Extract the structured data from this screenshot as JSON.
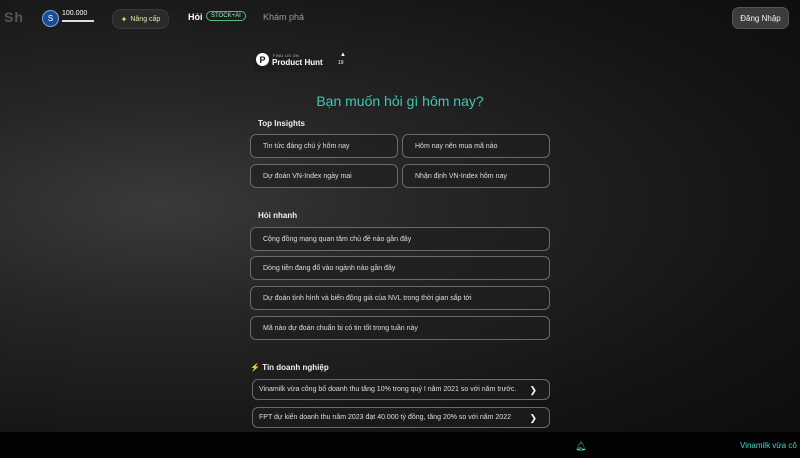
{
  "header": {
    "logo": "Sh",
    "coin_label": "S",
    "balance": "100.000",
    "upgrade_label": "Nâng cấp",
    "nav_ask": "Hỏi",
    "nav_badge": "STOCK+AI",
    "nav_explore": "Khám phá",
    "login_label": "Đăng Nhập"
  },
  "product_hunt": {
    "small_text": "FIND US ON",
    "name": "Product Hunt",
    "arrow": "▲",
    "count": "19",
    "logo_letter": "P"
  },
  "question": "Bạn muốn hỏi gì hôm nay?",
  "top_insights": {
    "title": "Top Insights",
    "items": [
      "Tin tức đáng chú ý hôm nay",
      "Hôm nay nên mua mã nào",
      "Dự đoán VN-Index ngày mai",
      "Nhận định VN-Index hôm nay"
    ]
  },
  "quick_ask": {
    "title": "Hỏi nhanh",
    "items": [
      "Cộng đồng mạng quan tâm chủ đề nào gần đây",
      "Dòng tiền đang đổ vào ngành nào gần đây",
      "Dự đoán tình hình và biến động giá của NVL trong thời gian sắp tới",
      "Mã nào dự đoán chuẩn bị có tin tốt trong tuần này"
    ]
  },
  "company_news": {
    "title": "Tin doanh nghiệp",
    "icon": "⚡",
    "items": [
      "Vinamilk vừa công bố doanh thu tăng 10% trong quý I năm 2021 so với năm trước.",
      "FPT dự kiến doanh thu năm 2023 đạt 40.000 tỷ đồng, tăng 20% so với năm 2022"
    ]
  },
  "footer": {
    "ticker": "Vinamilk vừa cô"
  },
  "colors": {
    "accent": "#3fc7b5",
    "badge_border": "#46c07a",
    "background": "#141414"
  },
  "icons": {
    "coin": "coin-icon",
    "upgrade": "sparkle-icon",
    "bell": "bell-icon",
    "chevron": "chevron-right-icon"
  }
}
